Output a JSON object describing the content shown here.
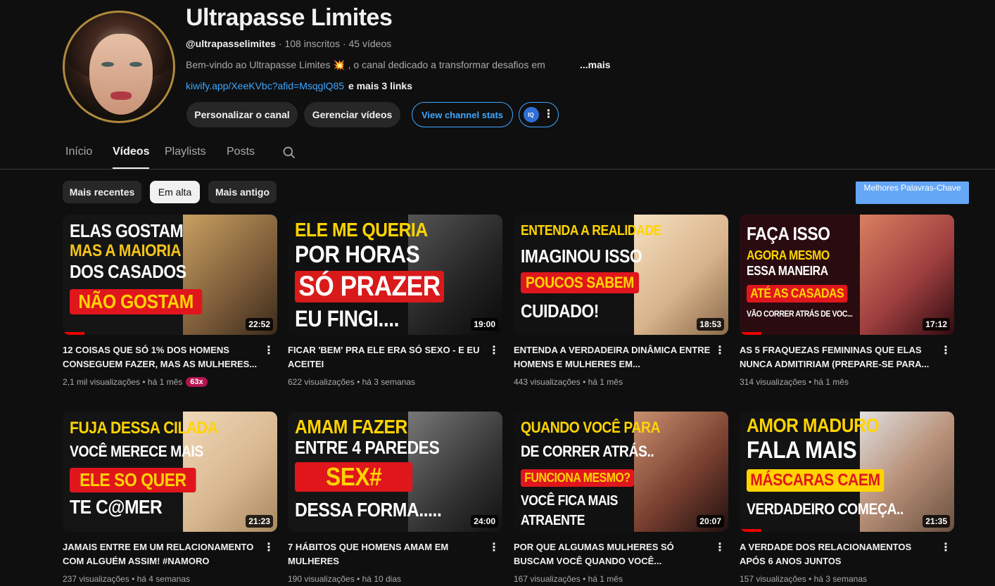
{
  "channel": {
    "name": "Ultrapasse Limites",
    "handle": "@ultrapasselimites",
    "stats": " · 108 inscritos · 45 vídeos",
    "description": "Bem-vindo ao Ultrapasse Limites 💥 , o canal dedicado a transformar desafios em",
    "more_label": "...mais",
    "link_url": "kiwify.app/XeeKVbc?afid=MsqglQ85",
    "link_extra": "e mais 3 links"
  },
  "buttons": {
    "customize": "Personalizar o canal",
    "manage": "Gerenciar vídeos",
    "stats": "View channel stats",
    "ext_logo": "IQ"
  },
  "tabs": [
    "Início",
    "Vídeos",
    "Playlists",
    "Posts"
  ],
  "chips": [
    "Mais recentes",
    "Em alta",
    "Mais antigo"
  ],
  "keywords_button": "Melhores Palavras-Chave",
  "colors": {
    "accent": "#3ea6ff",
    "progress": "#ff0000",
    "badge": "#b3154f",
    "keywords_button": "#65a7f7"
  },
  "videos": [
    {
      "title": "12 COISAS QUE SÓ 1% DOS HOMENS CONSEGUEM FAZER, MAS AS MULHERES...",
      "views": "2,1 mil visualizações",
      "age": "há 1 mês",
      "badge": "63x",
      "duration": "22:52",
      "progress": 0.1,
      "thumb": {
        "lines": [
          "ELAS GOSTAM",
          "MAS A MAIORIA",
          "DOS CASADOS",
          "NÃO GOSTAM"
        ]
      }
    },
    {
      "title": "FICAR 'BEM' PRA ELE ERA SÓ SEXO - E EU ACEITEI",
      "views": "622 visualizações",
      "age": "há 3 semanas",
      "duration": "19:00",
      "progress": 0,
      "thumb": {
        "lines": [
          "ELE ME QUERIA",
          "POR HORAS",
          "SÓ PRAZER",
          "EU FINGI...."
        ]
      }
    },
    {
      "title": "ENTENDA A VERDADEIRA DINÂMICA ENTRE HOMENS E MULHERES EM...",
      "views": "443 visualizações",
      "age": "há 1 mês",
      "duration": "18:53",
      "progress": 0,
      "thumb": {
        "lines": [
          "ENTENDA A REALIDADE",
          "IMAGINOU ISSO",
          "POUCOS SABEM",
          "CUIDADO!"
        ]
      }
    },
    {
      "title": "AS 5 FRAQUEZAS FEMININAS QUE ELAS NUNCA ADMITIRIAM (PREPARE-SE PARA...",
      "views": "314 visualizações",
      "age": "há 1 mês",
      "duration": "17:12",
      "progress": 0.1,
      "thumb": {
        "lines": [
          "FAÇA ISSO",
          "AGORA MESMO",
          "ESSA MANEIRA",
          "ATÉ AS CASADAS",
          "VÃO CORRER ATRÁS DE VOC..."
        ]
      }
    },
    {
      "title": "JAMAIS ENTRE EM UM RELACIONAMENTO COM ALGUÉM ASSIM! #NAMORO",
      "views": "237 visualizações",
      "age": "há 4 semanas",
      "duration": "21:23",
      "progress": 0,
      "thumb": {
        "lines": [
          "FUJA DESSA CILADA",
          "VOCÊ MERECE MAIS",
          "ELE SO QUER",
          "TE C@MER"
        ]
      }
    },
    {
      "title": "7 HÁBITOS QUE HOMENS AMAM EM MULHERES",
      "views": "190 visualizações",
      "age": "há 10 dias",
      "duration": "24:00",
      "progress": 0,
      "thumb": {
        "lines": [
          "AMAM FAZER",
          "ENTRE 4 PAREDES",
          "SEX#",
          "DESSA FORMA....."
        ]
      }
    },
    {
      "title": "POR QUE ALGUMAS MULHERES SÓ BUSCAM VOCÊ QUANDO VOCÊ...",
      "views": "167 visualizações",
      "age": "há 1 mês",
      "duration": "20:07",
      "progress": 0,
      "thumb": {
        "lines": [
          "QUANDO VOCÊ PARA",
          "DE CORRER ATRÁS..",
          "FUNCIONA MESMO?",
          "VOCÊ FICA MAIS",
          "ATRAENTE"
        ]
      }
    },
    {
      "title": "A VERDADE DOS RELACIONAMENTOS APÓS 6 ANOS JUNTOS",
      "views": "157 visualizações",
      "age": "há 3 semanas",
      "duration": "21:35",
      "progress": 0.1,
      "thumb": {
        "lines": [
          "AMOR MADURO",
          "FALA MAIS",
          "MÁSCARAS CAEM",
          "VERDADEIRO COMEÇA.."
        ]
      }
    }
  ]
}
